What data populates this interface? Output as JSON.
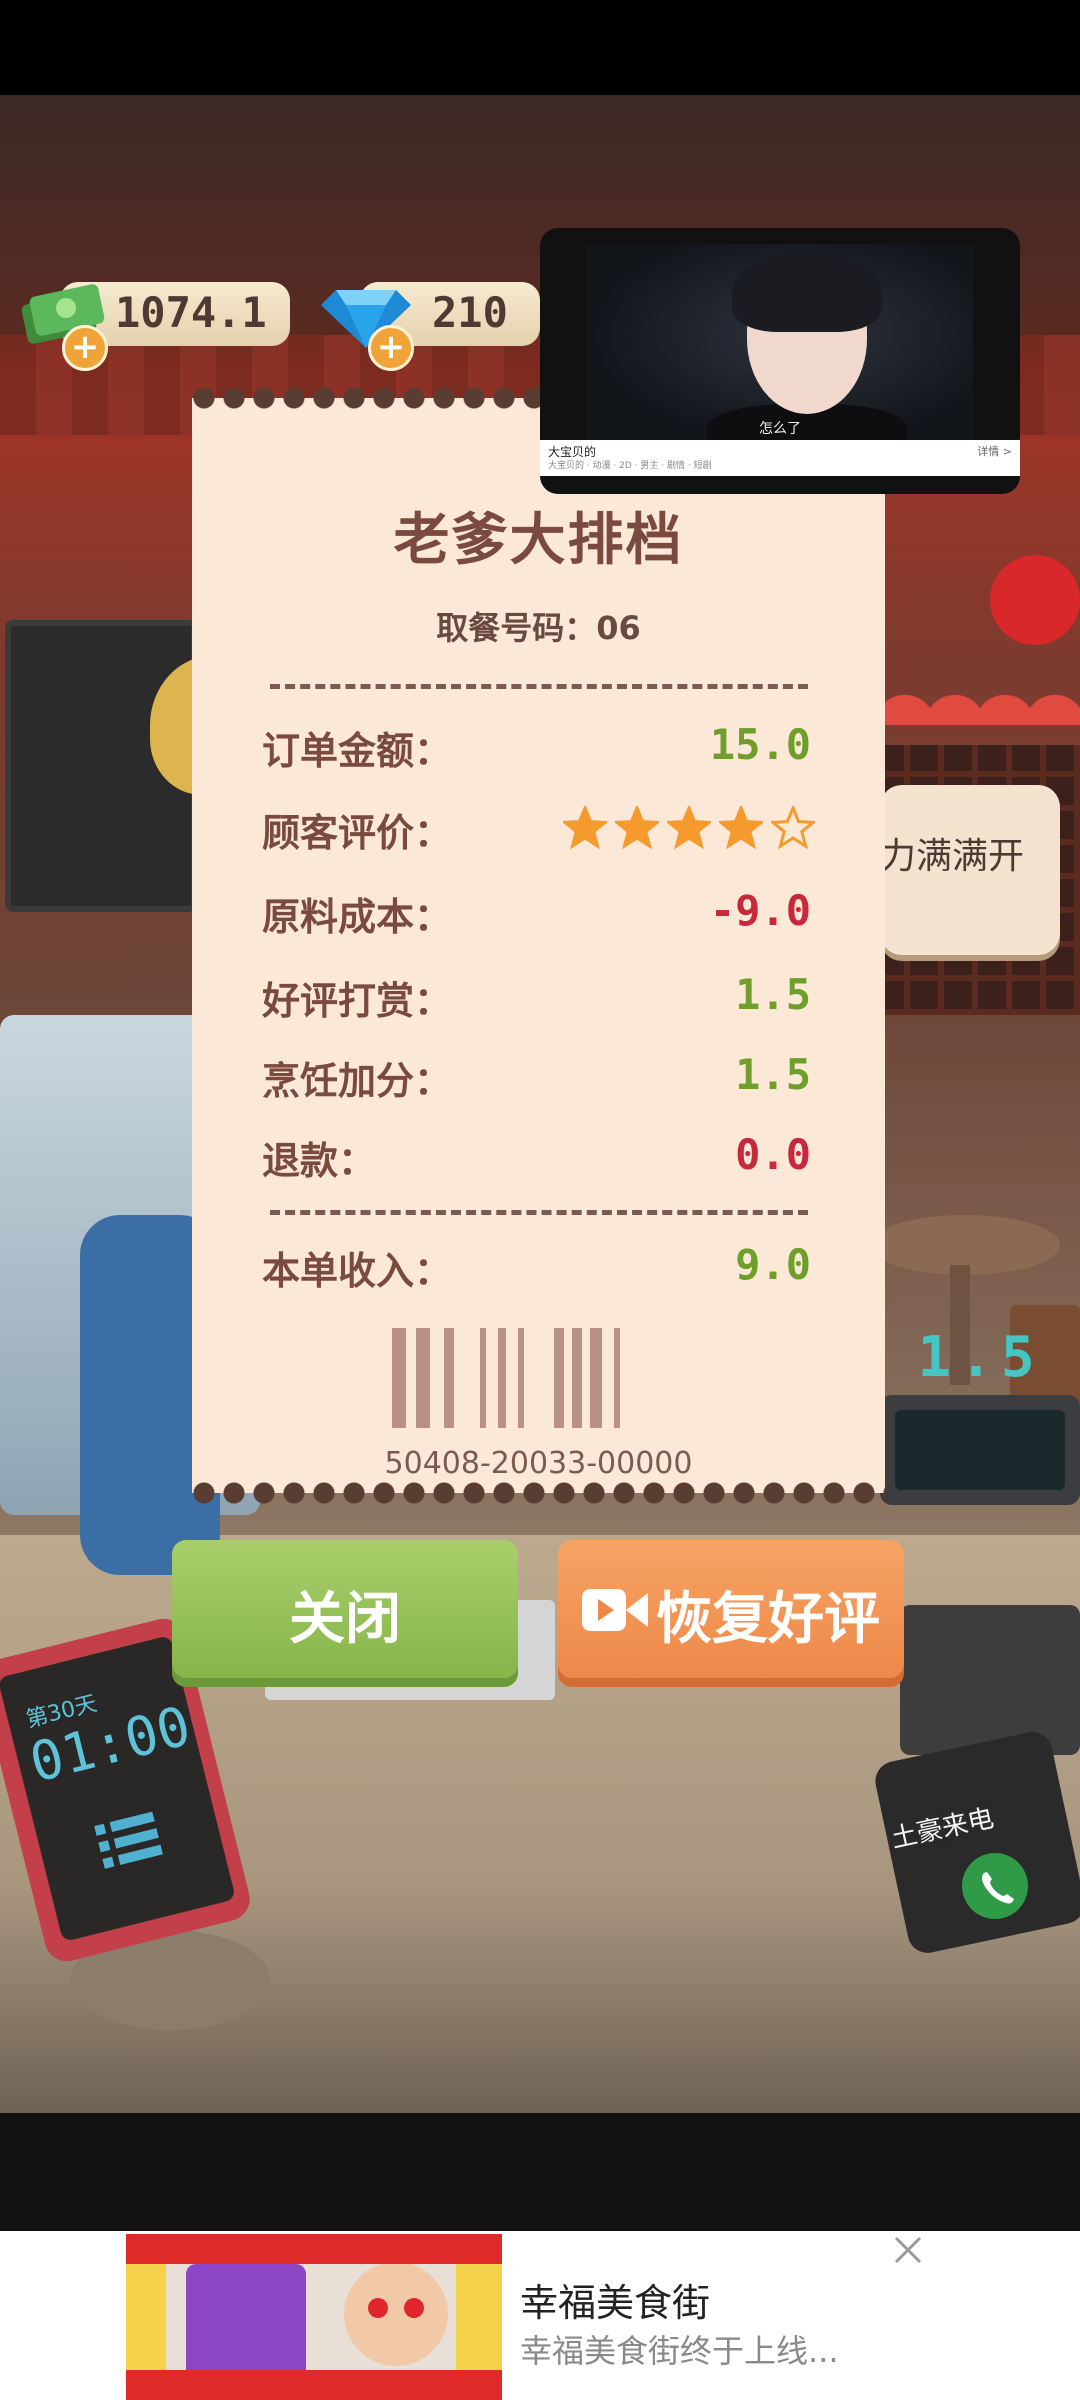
{
  "resources": {
    "money": "1074.1",
    "gems": "210",
    "plus": "+"
  },
  "video_ad": {
    "title": "大宝贝的",
    "subtitle": "怎么了",
    "meta": "大宝贝的 · 动漫 · 2D · 男主 · 剧情 · 短剧",
    "more": "详情 >"
  },
  "receipt": {
    "title": "老爹大排档",
    "pickup_number": "取餐号码：06",
    "rows": [
      {
        "label": "订单金额：",
        "value": "15.0",
        "tone": "green"
      },
      {
        "label": "顾客评价：",
        "stars": 4,
        "max_stars": 5
      },
      {
        "label": "原料成本：",
        "value": "-9.0",
        "tone": "red"
      },
      {
        "label": "好评打赏：",
        "value": "1.5",
        "tone": "green"
      },
      {
        "label": "烹饪加分：",
        "value": "1.5",
        "tone": "green"
      },
      {
        "label": "退款：",
        "value": "0.0",
        "tone": "red"
      }
    ],
    "total_label": "本单收入：",
    "total_value": "9.0",
    "barcode_number": "50408-20033-00000"
  },
  "buttons": {
    "close": "关闭",
    "restore": "恢复好评"
  },
  "scene": {
    "bubble_text": "力满满开",
    "scale_value": "1.5",
    "tablet_day": "第30天",
    "tablet_time": "01:00",
    "phone_label": "土豪来电"
  },
  "ad": {
    "title": "幸福美食街",
    "description": "幸福美食街终于上线..."
  },
  "colors": {
    "green_value": "#6f9e2a",
    "red_value": "#c8283c",
    "close_button": "#93c257",
    "restore_button": "#f29553",
    "receipt_bg": "#fbe8d7",
    "star_fill": "#f59a2c"
  }
}
